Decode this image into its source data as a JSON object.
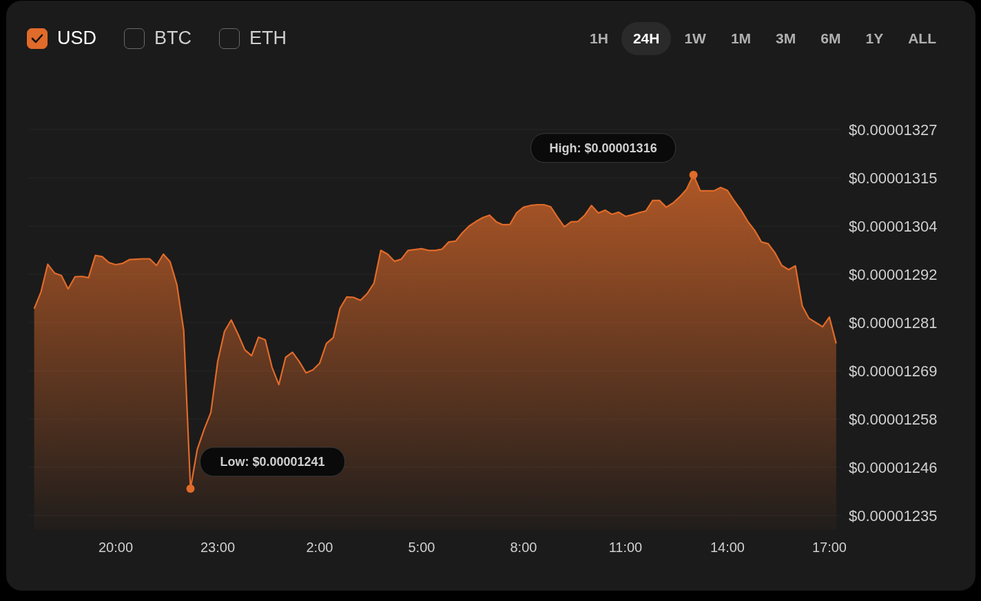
{
  "currencies": [
    {
      "label": "USD",
      "checked": true
    },
    {
      "label": "BTC",
      "checked": false
    },
    {
      "label": "ETH",
      "checked": false
    }
  ],
  "ranges": [
    {
      "label": "1H",
      "selected": false
    },
    {
      "label": "24H",
      "selected": true
    },
    {
      "label": "1W",
      "selected": false
    },
    {
      "label": "1M",
      "selected": false
    },
    {
      "label": "3M",
      "selected": false
    },
    {
      "label": "6M",
      "selected": false
    },
    {
      "label": "1Y",
      "selected": false
    },
    {
      "label": "ALL",
      "selected": false
    }
  ],
  "chart": {
    "chart_data": {
      "type": "area",
      "categories": [
        null,
        null,
        null,
        null,
        null,
        null,
        null,
        null,
        null,
        null,
        null,
        null,
        "20:00",
        null,
        null,
        null,
        null,
        null,
        null,
        null,
        null,
        null,
        null,
        null,
        null,
        null,
        null,
        "23:00",
        null,
        null,
        null,
        null,
        null,
        null,
        null,
        null,
        null,
        null,
        null,
        null,
        null,
        null,
        "2:00",
        null,
        null,
        null,
        null,
        null,
        null,
        null,
        null,
        null,
        null,
        null,
        null,
        null,
        null,
        "5:00",
        null,
        null,
        null,
        null,
        null,
        null,
        null,
        null,
        null,
        null,
        null,
        null,
        null,
        null,
        "8:00",
        null,
        null,
        null,
        null,
        null,
        null,
        null,
        null,
        null,
        null,
        null,
        null,
        null,
        null,
        "11:00",
        null,
        null,
        null,
        null,
        null,
        null,
        null,
        null,
        null,
        null,
        null,
        null,
        null,
        null,
        "14:00",
        null,
        null,
        null,
        null,
        null,
        null,
        null,
        null,
        null,
        null,
        null,
        null,
        null,
        null,
        "17:00",
        null
      ],
      "series": [
        {
          "color": "#e06b2a",
          "values": [
            1.2843e-05,
            1.2883e-05,
            1.2949e-05,
            1.2928e-05,
            1.2922e-05,
            1.289e-05,
            1.2919e-05,
            1.292e-05,
            1.2917e-05,
            1.297e-05,
            1.2967e-05,
            1.2953e-05,
            1.2948e-05,
            1.2951e-05,
            1.296e-05,
            1.2961e-05,
            1.2962e-05,
            1.2962e-05,
            1.2946e-05,
            1.2973e-05,
            1.2955e-05,
            1.29e-05,
            1.2791e-05,
            1.2414e-05,
            1.2508e-05,
            1.2555e-05,
            1.2596e-05,
            1.2717e-05,
            1.2789e-05,
            1.2816e-05,
            1.2782e-05,
            1.2745e-05,
            1.2731e-05,
            1.2775e-05,
            1.2769e-05,
            1.2703e-05,
            1.2662e-05,
            1.2727e-05,
            1.2739e-05,
            1.2717e-05,
            1.269e-05,
            1.2697e-05,
            1.2713e-05,
            1.276e-05,
            1.2774e-05,
            1.2844e-05,
            1.2871e-05,
            1.287e-05,
            1.2863e-05,
            1.2879e-05,
            1.2904e-05,
            1.2982e-05,
            1.2973e-05,
            1.2956e-05,
            1.2961e-05,
            1.2982e-05,
            1.2984e-05,
            1.2986e-05,
            1.2982e-05,
            1.2982e-05,
            1.2985e-05,
            1.3002e-05,
            1.3004e-05,
            1.3024e-05,
            1.304e-05,
            1.3051e-05,
            1.306e-05,
            1.3066e-05,
            1.305e-05,
            1.3043e-05,
            1.3044e-05,
            1.3072e-05,
            1.3085e-05,
            1.3089e-05,
            1.3091e-05,
            1.3091e-05,
            1.3086e-05,
            1.3061e-05,
            1.3038e-05,
            1.305e-05,
            1.3051e-05,
            1.3066e-05,
            1.3089e-05,
            1.3071e-05,
            1.3078e-05,
            1.3068e-05,
            1.3073e-05,
            1.3063e-05,
            1.3067e-05,
            1.3072e-05,
            1.3076e-05,
            1.3101e-05,
            1.3101e-05,
            1.3085e-05,
            1.3095e-05,
            1.311e-05,
            1.3128e-05,
            1.3162e-05,
            1.3124e-05,
            1.3124e-05,
            1.3124e-05,
            1.3132e-05,
            1.3125e-05,
            1.31e-05,
            1.3078e-05,
            1.3051e-05,
            1.303e-05,
            1.3002e-05,
            1.2998e-05,
            1.2976e-05,
            1.2946e-05,
            1.2936e-05,
            1.2945e-05,
            1.285e-05,
            1.282e-05,
            1.281e-05,
            1.28e-05,
            1.2823e-05,
            1.276e-05
          ]
        }
      ],
      "ylim": [
        1.235e-05,
        1.327e-05
      ],
      "yticks": [
        {
          "value": 1.327e-05,
          "label": "$0.00001327"
        },
        {
          "value": 1.3155e-05,
          "label": "$0.00001315"
        },
        {
          "value": 1.304e-05,
          "label": "$0.00001304"
        },
        {
          "value": 1.2925e-05,
          "label": "$0.00001292"
        },
        {
          "value": 1.281e-05,
          "label": "$0.00001281"
        },
        {
          "value": 1.2695e-05,
          "label": "$0.00001269"
        },
        {
          "value": 1.258e-05,
          "label": "$0.00001258"
        },
        {
          "value": 1.2465e-05,
          "label": "$0.00001246"
        },
        {
          "value": 1.235e-05,
          "label": "$0.00001235"
        }
      ],
      "annotations": [
        "High: $0.00001316",
        "Low: $0.00001241"
      ]
    }
  }
}
